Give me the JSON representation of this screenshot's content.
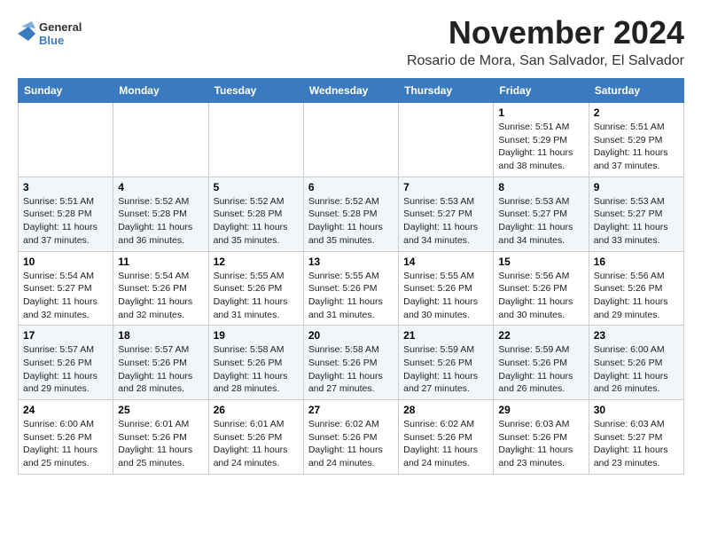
{
  "logo": {
    "line1": "General",
    "line2": "Blue"
  },
  "title": "November 2024",
  "location": "Rosario de Mora, San Salvador, El Salvador",
  "weekdays": [
    "Sunday",
    "Monday",
    "Tuesday",
    "Wednesday",
    "Thursday",
    "Friday",
    "Saturday"
  ],
  "weeks": [
    [
      {
        "day": "",
        "info": ""
      },
      {
        "day": "",
        "info": ""
      },
      {
        "day": "",
        "info": ""
      },
      {
        "day": "",
        "info": ""
      },
      {
        "day": "",
        "info": ""
      },
      {
        "day": "1",
        "info": "Sunrise: 5:51 AM\nSunset: 5:29 PM\nDaylight: 11 hours\nand 38 minutes."
      },
      {
        "day": "2",
        "info": "Sunrise: 5:51 AM\nSunset: 5:29 PM\nDaylight: 11 hours\nand 37 minutes."
      }
    ],
    [
      {
        "day": "3",
        "info": "Sunrise: 5:51 AM\nSunset: 5:28 PM\nDaylight: 11 hours\nand 37 minutes."
      },
      {
        "day": "4",
        "info": "Sunrise: 5:52 AM\nSunset: 5:28 PM\nDaylight: 11 hours\nand 36 minutes."
      },
      {
        "day": "5",
        "info": "Sunrise: 5:52 AM\nSunset: 5:28 PM\nDaylight: 11 hours\nand 35 minutes."
      },
      {
        "day": "6",
        "info": "Sunrise: 5:52 AM\nSunset: 5:28 PM\nDaylight: 11 hours\nand 35 minutes."
      },
      {
        "day": "7",
        "info": "Sunrise: 5:53 AM\nSunset: 5:27 PM\nDaylight: 11 hours\nand 34 minutes."
      },
      {
        "day": "8",
        "info": "Sunrise: 5:53 AM\nSunset: 5:27 PM\nDaylight: 11 hours\nand 34 minutes."
      },
      {
        "day": "9",
        "info": "Sunrise: 5:53 AM\nSunset: 5:27 PM\nDaylight: 11 hours\nand 33 minutes."
      }
    ],
    [
      {
        "day": "10",
        "info": "Sunrise: 5:54 AM\nSunset: 5:27 PM\nDaylight: 11 hours\nand 32 minutes."
      },
      {
        "day": "11",
        "info": "Sunrise: 5:54 AM\nSunset: 5:26 PM\nDaylight: 11 hours\nand 32 minutes."
      },
      {
        "day": "12",
        "info": "Sunrise: 5:55 AM\nSunset: 5:26 PM\nDaylight: 11 hours\nand 31 minutes."
      },
      {
        "day": "13",
        "info": "Sunrise: 5:55 AM\nSunset: 5:26 PM\nDaylight: 11 hours\nand 31 minutes."
      },
      {
        "day": "14",
        "info": "Sunrise: 5:55 AM\nSunset: 5:26 PM\nDaylight: 11 hours\nand 30 minutes."
      },
      {
        "day": "15",
        "info": "Sunrise: 5:56 AM\nSunset: 5:26 PM\nDaylight: 11 hours\nand 30 minutes."
      },
      {
        "day": "16",
        "info": "Sunrise: 5:56 AM\nSunset: 5:26 PM\nDaylight: 11 hours\nand 29 minutes."
      }
    ],
    [
      {
        "day": "17",
        "info": "Sunrise: 5:57 AM\nSunset: 5:26 PM\nDaylight: 11 hours\nand 29 minutes."
      },
      {
        "day": "18",
        "info": "Sunrise: 5:57 AM\nSunset: 5:26 PM\nDaylight: 11 hours\nand 28 minutes."
      },
      {
        "day": "19",
        "info": "Sunrise: 5:58 AM\nSunset: 5:26 PM\nDaylight: 11 hours\nand 28 minutes."
      },
      {
        "day": "20",
        "info": "Sunrise: 5:58 AM\nSunset: 5:26 PM\nDaylight: 11 hours\nand 27 minutes."
      },
      {
        "day": "21",
        "info": "Sunrise: 5:59 AM\nSunset: 5:26 PM\nDaylight: 11 hours\nand 27 minutes."
      },
      {
        "day": "22",
        "info": "Sunrise: 5:59 AM\nSunset: 5:26 PM\nDaylight: 11 hours\nand 26 minutes."
      },
      {
        "day": "23",
        "info": "Sunrise: 6:00 AM\nSunset: 5:26 PM\nDaylight: 11 hours\nand 26 minutes."
      }
    ],
    [
      {
        "day": "24",
        "info": "Sunrise: 6:00 AM\nSunset: 5:26 PM\nDaylight: 11 hours\nand 25 minutes."
      },
      {
        "day": "25",
        "info": "Sunrise: 6:01 AM\nSunset: 5:26 PM\nDaylight: 11 hours\nand 25 minutes."
      },
      {
        "day": "26",
        "info": "Sunrise: 6:01 AM\nSunset: 5:26 PM\nDaylight: 11 hours\nand 24 minutes."
      },
      {
        "day": "27",
        "info": "Sunrise: 6:02 AM\nSunset: 5:26 PM\nDaylight: 11 hours\nand 24 minutes."
      },
      {
        "day": "28",
        "info": "Sunrise: 6:02 AM\nSunset: 5:26 PM\nDaylight: 11 hours\nand 24 minutes."
      },
      {
        "day": "29",
        "info": "Sunrise: 6:03 AM\nSunset: 5:26 PM\nDaylight: 11 hours\nand 23 minutes."
      },
      {
        "day": "30",
        "info": "Sunrise: 6:03 AM\nSunset: 5:27 PM\nDaylight: 11 hours\nand 23 minutes."
      }
    ]
  ]
}
